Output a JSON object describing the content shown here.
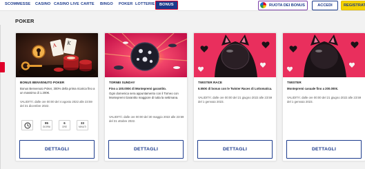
{
  "nav": {
    "items": [
      {
        "label": "SCOMMESSE"
      },
      {
        "label": "CASINO"
      },
      {
        "label": "CASINO LIVE"
      },
      {
        "label": "CARTE"
      },
      {
        "label": "BINGO"
      },
      {
        "label": "POKER"
      },
      {
        "label": "LOTTERIE"
      },
      {
        "label": "BONUS"
      }
    ],
    "ruota_label": "RUOTA DEI BONUS",
    "accedi_label": "ACCEDI",
    "registrati_label": "REGISTRATI"
  },
  "section_title": "POKER",
  "cards": [
    {
      "title": "BONUS BENVENUTO POKER",
      "description": "Bonus Benvenuto Poker, 300% della prima ricarica fino a un massimo di 1.200€.",
      "validity": "VALIDITÀ: dalle ore 00:00 del 4 agosto 2022 alle 23:59 del 31 dicembre 2022.",
      "countdown": [
        {
          "num": "95",
          "label": "GIORNI"
        },
        {
          "num": "6",
          "label": "ORE"
        },
        {
          "num": "33",
          "label": "MINUTI"
        }
      ],
      "button": "DETTAGLI"
    },
    {
      "title": "TORNEI SUNDAY",
      "subtitle": "Fino a 100.000€ di Montepremi garantito.",
      "description": "Ogni domenica sera appuntamento con il Torneo con Montepremi Garantito maggiore di tutta la settimana.",
      "validity": "VALIDITÀ: dalle ore 00:00 del 30 maggio 2022 alle 23:59 del 31 ottobre 2022.",
      "button": "DETTAGLI"
    },
    {
      "title": "TWISTER RACE",
      "subtitle": "6.550€ di bonus con le Twister Races di Lottomatica.",
      "validity": "VALIDITÀ: dalle ore 00:00 del 21 giugno 2022 alle 23:59 del 1 gennaio 2023.",
      "button": "DETTAGLI"
    },
    {
      "title": "TWISTER",
      "subtitle": "Montepremi casuale fino a 200.000€.",
      "validity": "VALIDITÀ: dalle ore 00:00 del 21 giugno 2022 alle 23:59 del 1 gennaio 2023.",
      "button": "DETTAGLI"
    }
  ],
  "colors": {
    "brand_blue": "#1b3a8c",
    "accent_red": "#e0002a",
    "register_yellow": "#f5d300"
  }
}
